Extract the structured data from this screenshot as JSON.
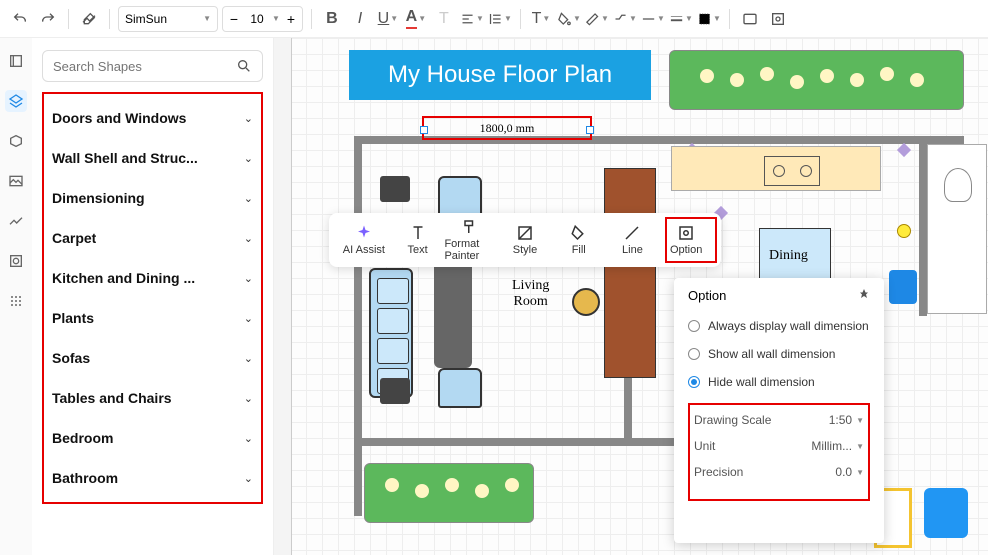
{
  "toolbar": {
    "font_name": "SimSun",
    "font_size": "10"
  },
  "sidebar": {
    "search_placeholder": "Search Shapes",
    "categories": [
      "Doors and Windows",
      "Wall Shell and Struc...",
      "Dimensioning",
      "Carpet",
      "Kitchen and Dining ...",
      "Plants",
      "Sofas",
      "Tables and Chairs",
      "Bedroom",
      "Bathroom"
    ]
  },
  "canvas": {
    "title": "My House Floor Plan",
    "dimension_value": "1800,0 mm",
    "living_label": "Living\nRoom",
    "dining_label": "Dining"
  },
  "context_menu": {
    "items": [
      "AI Assist",
      "Text",
      "Format Painter",
      "Style",
      "Fill",
      "Line",
      "Option"
    ]
  },
  "option_panel": {
    "title": "Option",
    "radios": [
      {
        "label": "Always display wall dimension",
        "checked": false
      },
      {
        "label": "Show all wall dimension",
        "checked": false
      },
      {
        "label": "Hide wall dimension",
        "checked": true
      }
    ],
    "fields": [
      {
        "label": "Drawing Scale",
        "value": "1:50"
      },
      {
        "label": "Unit",
        "value": "Millim..."
      },
      {
        "label": "Precision",
        "value": "0.0"
      }
    ]
  }
}
